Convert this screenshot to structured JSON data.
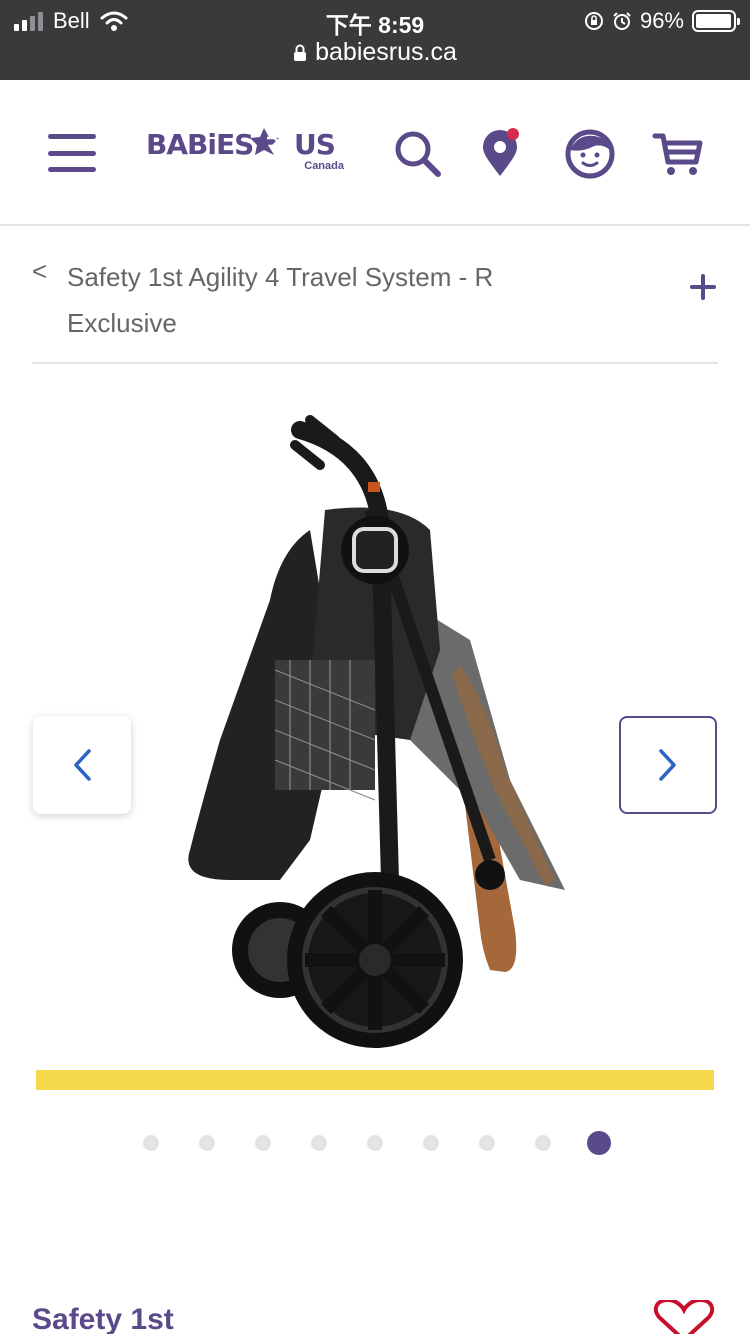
{
  "status_bar": {
    "carrier": "Bell",
    "time": "下午 8:59",
    "battery_percent": "96%",
    "battery_level": 0.96,
    "url": "babiesrus.ca"
  },
  "header": {
    "logo_text": "BABiES R US",
    "logo_subtext": "Canada",
    "icons": [
      "menu-icon",
      "search-icon",
      "store-locator-icon",
      "account-icon",
      "cart-icon"
    ],
    "brand_color": "#5a4a8a",
    "notification_color": "#d62b4b"
  },
  "breadcrumb": {
    "back_symbol": "<",
    "title": "Safety 1st Agility 4 Travel System - R Exclusive",
    "expand_symbol": "+"
  },
  "gallery": {
    "image_alt": "Folded stroller",
    "slide_count": 9,
    "active_index": 8,
    "accent_color": "#f5d84b"
  },
  "product": {
    "brand": "Safety 1st"
  }
}
